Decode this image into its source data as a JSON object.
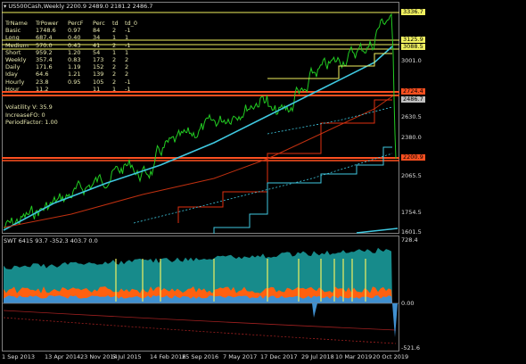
{
  "chart": {
    "title": "US500Cash,Weekly  2200.9 2489.0 2181.2 2486.7",
    "dropdown_icon": "triangle-down-icon"
  },
  "table": {
    "headers": [
      "TrName",
      "TrPower",
      "PercF",
      "Perc",
      "td",
      "td_0"
    ],
    "rows": [
      [
        "Basic",
        "1748.6",
        "0.97",
        "84",
        "2",
        "-1"
      ],
      [
        "Long",
        "687.4",
        "0.40",
        "34",
        "1",
        "1"
      ],
      [
        "Medium",
        "570.0",
        "0.43",
        "41",
        "2",
        "-1"
      ],
      [
        "Short",
        "959.2",
        "1.20",
        "54",
        "1",
        "1"
      ],
      [
        "Weekly",
        "357.4",
        "0.83",
        "173",
        "2",
        "2"
      ],
      [
        "Daily",
        "171.6",
        "1.19",
        "152",
        "2",
        "2"
      ],
      [
        "Iday",
        "64.6",
        "1.21",
        "139",
        "2",
        "2"
      ],
      [
        "Hourly",
        "23.8",
        "0.95",
        "105",
        "2",
        "-1"
      ],
      [
        "Hour",
        "11.2",
        "",
        "11",
        "1",
        "-1"
      ]
    ]
  },
  "info": {
    "line1": "Volatility V: 35.9",
    "line2": "IncreaseFO: 0",
    "line3": "PeriodFactor: 1.00"
  },
  "price_axis": {
    "ticks": [
      "3469.0",
      "3001.0",
      "2630.5",
      "2380.0",
      "2065.5",
      "1754.5",
      "1601.5"
    ],
    "tags": [
      {
        "label": "3336.7",
        "color": "#f0f060"
      },
      {
        "label": "3125.9",
        "color": "#f0f060"
      },
      {
        "label": "3088.5",
        "color": "#f0f060"
      },
      {
        "label": "2724.4",
        "color": "#ff5020"
      },
      {
        "label": "2486.7",
        "color": "#c0c0c0"
      },
      {
        "label": "2200.9",
        "color": "#ff5020"
      }
    ]
  },
  "sub": {
    "title": "SWT 6415 93.7 -352.3 403.7 0.0",
    "ticks": [
      "728.4",
      "0.00",
      "-521.6"
    ]
  },
  "time_axis": {
    "labels": [
      "1 Sep 2013",
      "13 Apr 2014",
      "23 Nov 2014",
      "5 Jul 2015",
      "14 Feb 2016",
      "25 Sep 2016",
      "7 May 2017",
      "17 Dec 2017",
      "29 Jul 2018",
      "10 Mar 2019",
      "20 Oct 2019"
    ]
  },
  "colors": {
    "price": "#22cc22",
    "basic": "#3fc8e0",
    "long": "#c03010",
    "short": "#f0f060",
    "orange": "#ff6010",
    "teal": "#1a9a9a"
  }
}
